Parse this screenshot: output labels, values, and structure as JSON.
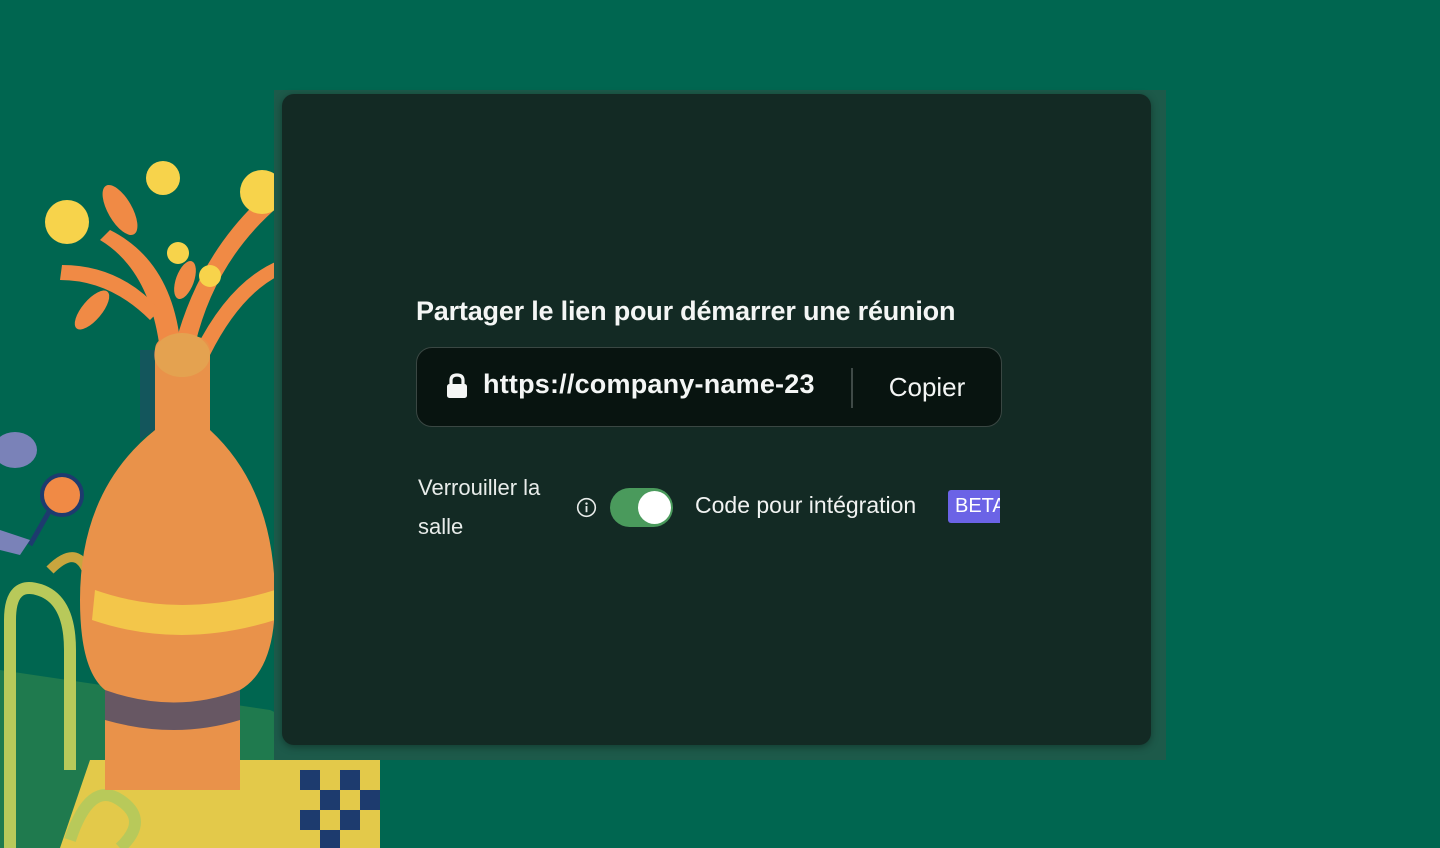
{
  "background_color": "#006650",
  "modal": {
    "background_color": "#132a24",
    "heading": "Partager le lien pour démarrer une réunion",
    "link": {
      "icon": "lock-icon",
      "url": "https://company-name-23",
      "copy_label": "Copier"
    },
    "lock_room": {
      "label": "Verrouiller la salle",
      "info_icon": "info-icon",
      "toggle_on": true,
      "toggle_color": "#4a9a5c"
    },
    "embed": {
      "label": "Code pour intégration",
      "badge": "BETA",
      "badge_color": "#6b63e6"
    }
  }
}
